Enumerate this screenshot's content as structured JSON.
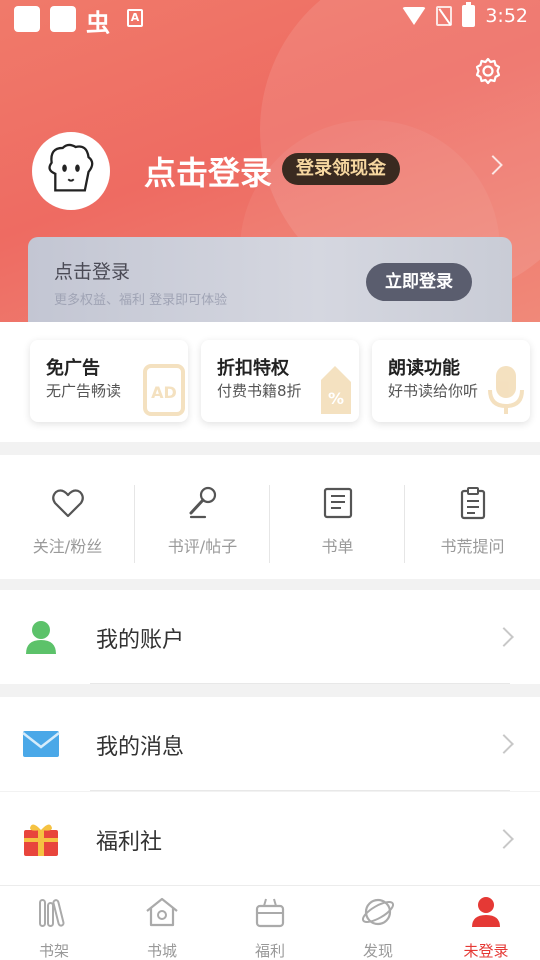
{
  "status_bar": {
    "glyph": "虫",
    "sim_letter": "A",
    "time": "3:52"
  },
  "header": {
    "login_title": "点击登录",
    "cash_badge": "登录领现金"
  },
  "login_card": {
    "title": "点击登录",
    "subtitle": "更多权益、福利 登录即可体验",
    "button": "立即登录"
  },
  "perks": [
    {
      "title": "免广告",
      "subtitle": "无广告畅读",
      "icon": "ad-icon"
    },
    {
      "title": "折扣特权",
      "subtitle": "付费书籍8折",
      "icon": "discount-tag-icon"
    },
    {
      "title": "朗读功能",
      "subtitle": "好书读给你听",
      "icon": "microphone-icon"
    }
  ],
  "quick_actions": [
    {
      "label": "关注/粉丝",
      "icon": "heart-icon"
    },
    {
      "label": "书评/帖子",
      "icon": "microphone-icon"
    },
    {
      "label": "书单",
      "icon": "book-list-icon"
    },
    {
      "label": "书荒提问",
      "icon": "clipboard-icon"
    }
  ],
  "menu": [
    {
      "label": "我的账户",
      "icon": "account-icon"
    },
    {
      "label": "我的消息",
      "icon": "mail-icon"
    },
    {
      "label": "福利社",
      "icon": "gift-icon"
    }
  ],
  "tabs": [
    {
      "label": "书架",
      "icon": "bookshelf-icon"
    },
    {
      "label": "书城",
      "icon": "bookstore-icon"
    },
    {
      "label": "福利",
      "icon": "welfare-icon"
    },
    {
      "label": "发现",
      "icon": "discover-icon"
    },
    {
      "label": "未登录",
      "icon": "user-icon"
    }
  ],
  "colors": {
    "accent": "#e53935",
    "header": "#ee6b62",
    "badge_bg": "#3a2a20",
    "badge_text": "#f6d7a0"
  }
}
